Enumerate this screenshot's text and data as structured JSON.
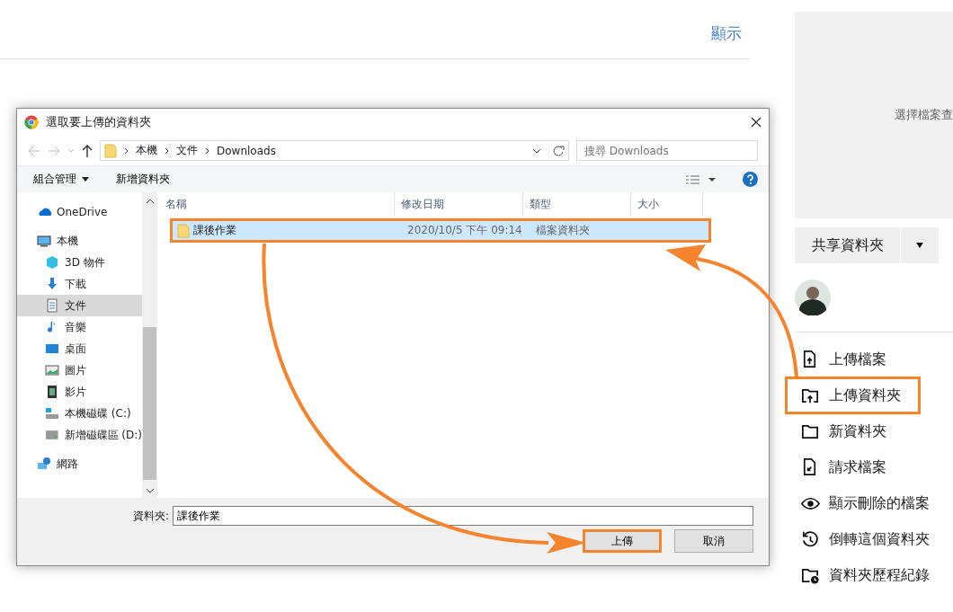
{
  "page": {
    "show_link": "顯示",
    "preview_text": "選擇檔案查",
    "share_button": "共享資料夾",
    "menu": [
      {
        "label": "上傳檔案",
        "kind": "upload-file",
        "highlighted": false
      },
      {
        "label": "上傳資料夾",
        "kind": "upload-folder",
        "highlighted": true
      },
      {
        "label": "新資料夾",
        "kind": "folder",
        "highlighted": false
      },
      {
        "label": "請求檔案",
        "kind": "request",
        "highlighted": false
      },
      {
        "label": "顯示刪除的檔案",
        "kind": "eye",
        "highlighted": false
      },
      {
        "label": "倒轉這個資料夾",
        "kind": "revert",
        "highlighted": false
      },
      {
        "label": "資料夾歷程紀錄",
        "kind": "history",
        "highlighted": false
      }
    ]
  },
  "dialog": {
    "title": "選取要上傳的資料夾",
    "breadcrumb": [
      "本機",
      "文件",
      "Downloads"
    ],
    "search": {
      "placeholder": "搜尋 Downloads"
    },
    "toolbar": [
      {
        "label": "組合管理",
        "kind": "menu"
      },
      {
        "label": "新增資料夾",
        "kind": "plain"
      }
    ],
    "nav_items": [
      {
        "label": "OneDrive",
        "kind": "cloud",
        "selected": false
      },
      {
        "label": "本機",
        "kind": "pc",
        "selected": false,
        "children": [
          {
            "label": "3D 物件",
            "kind": "cube",
            "selected": false
          },
          {
            "label": "下載",
            "kind": "download",
            "selected": false
          },
          {
            "label": "文件",
            "kind": "document",
            "selected": true
          },
          {
            "label": "音樂",
            "kind": "music",
            "selected": false
          },
          {
            "label": "桌面",
            "kind": "desktop",
            "selected": false
          },
          {
            "label": "圖片",
            "kind": "pictures",
            "selected": false
          },
          {
            "label": "影片",
            "kind": "video",
            "selected": false
          },
          {
            "label": "本機磁碟 (C:)",
            "kind": "drive-c",
            "selected": false
          },
          {
            "label": "新增磁碟區 (D:)",
            "kind": "drive",
            "selected": false
          }
        ]
      },
      {
        "label": "網路",
        "kind": "network",
        "selected": false
      }
    ],
    "columns": [
      "名稱",
      "修改日期",
      "類型",
      "大小"
    ],
    "rows": [
      {
        "name": "課後作業",
        "modified": "2020/10/5 下午 09:14",
        "type": "檔案資料夾",
        "selected": true,
        "highlighted": true
      }
    ],
    "folder_label": "資料夾:",
    "folder_value": "課後作業",
    "buttons": [
      {
        "label": "上傳",
        "highlighted": true
      },
      {
        "label": "取消",
        "highlighted": false
      }
    ]
  }
}
